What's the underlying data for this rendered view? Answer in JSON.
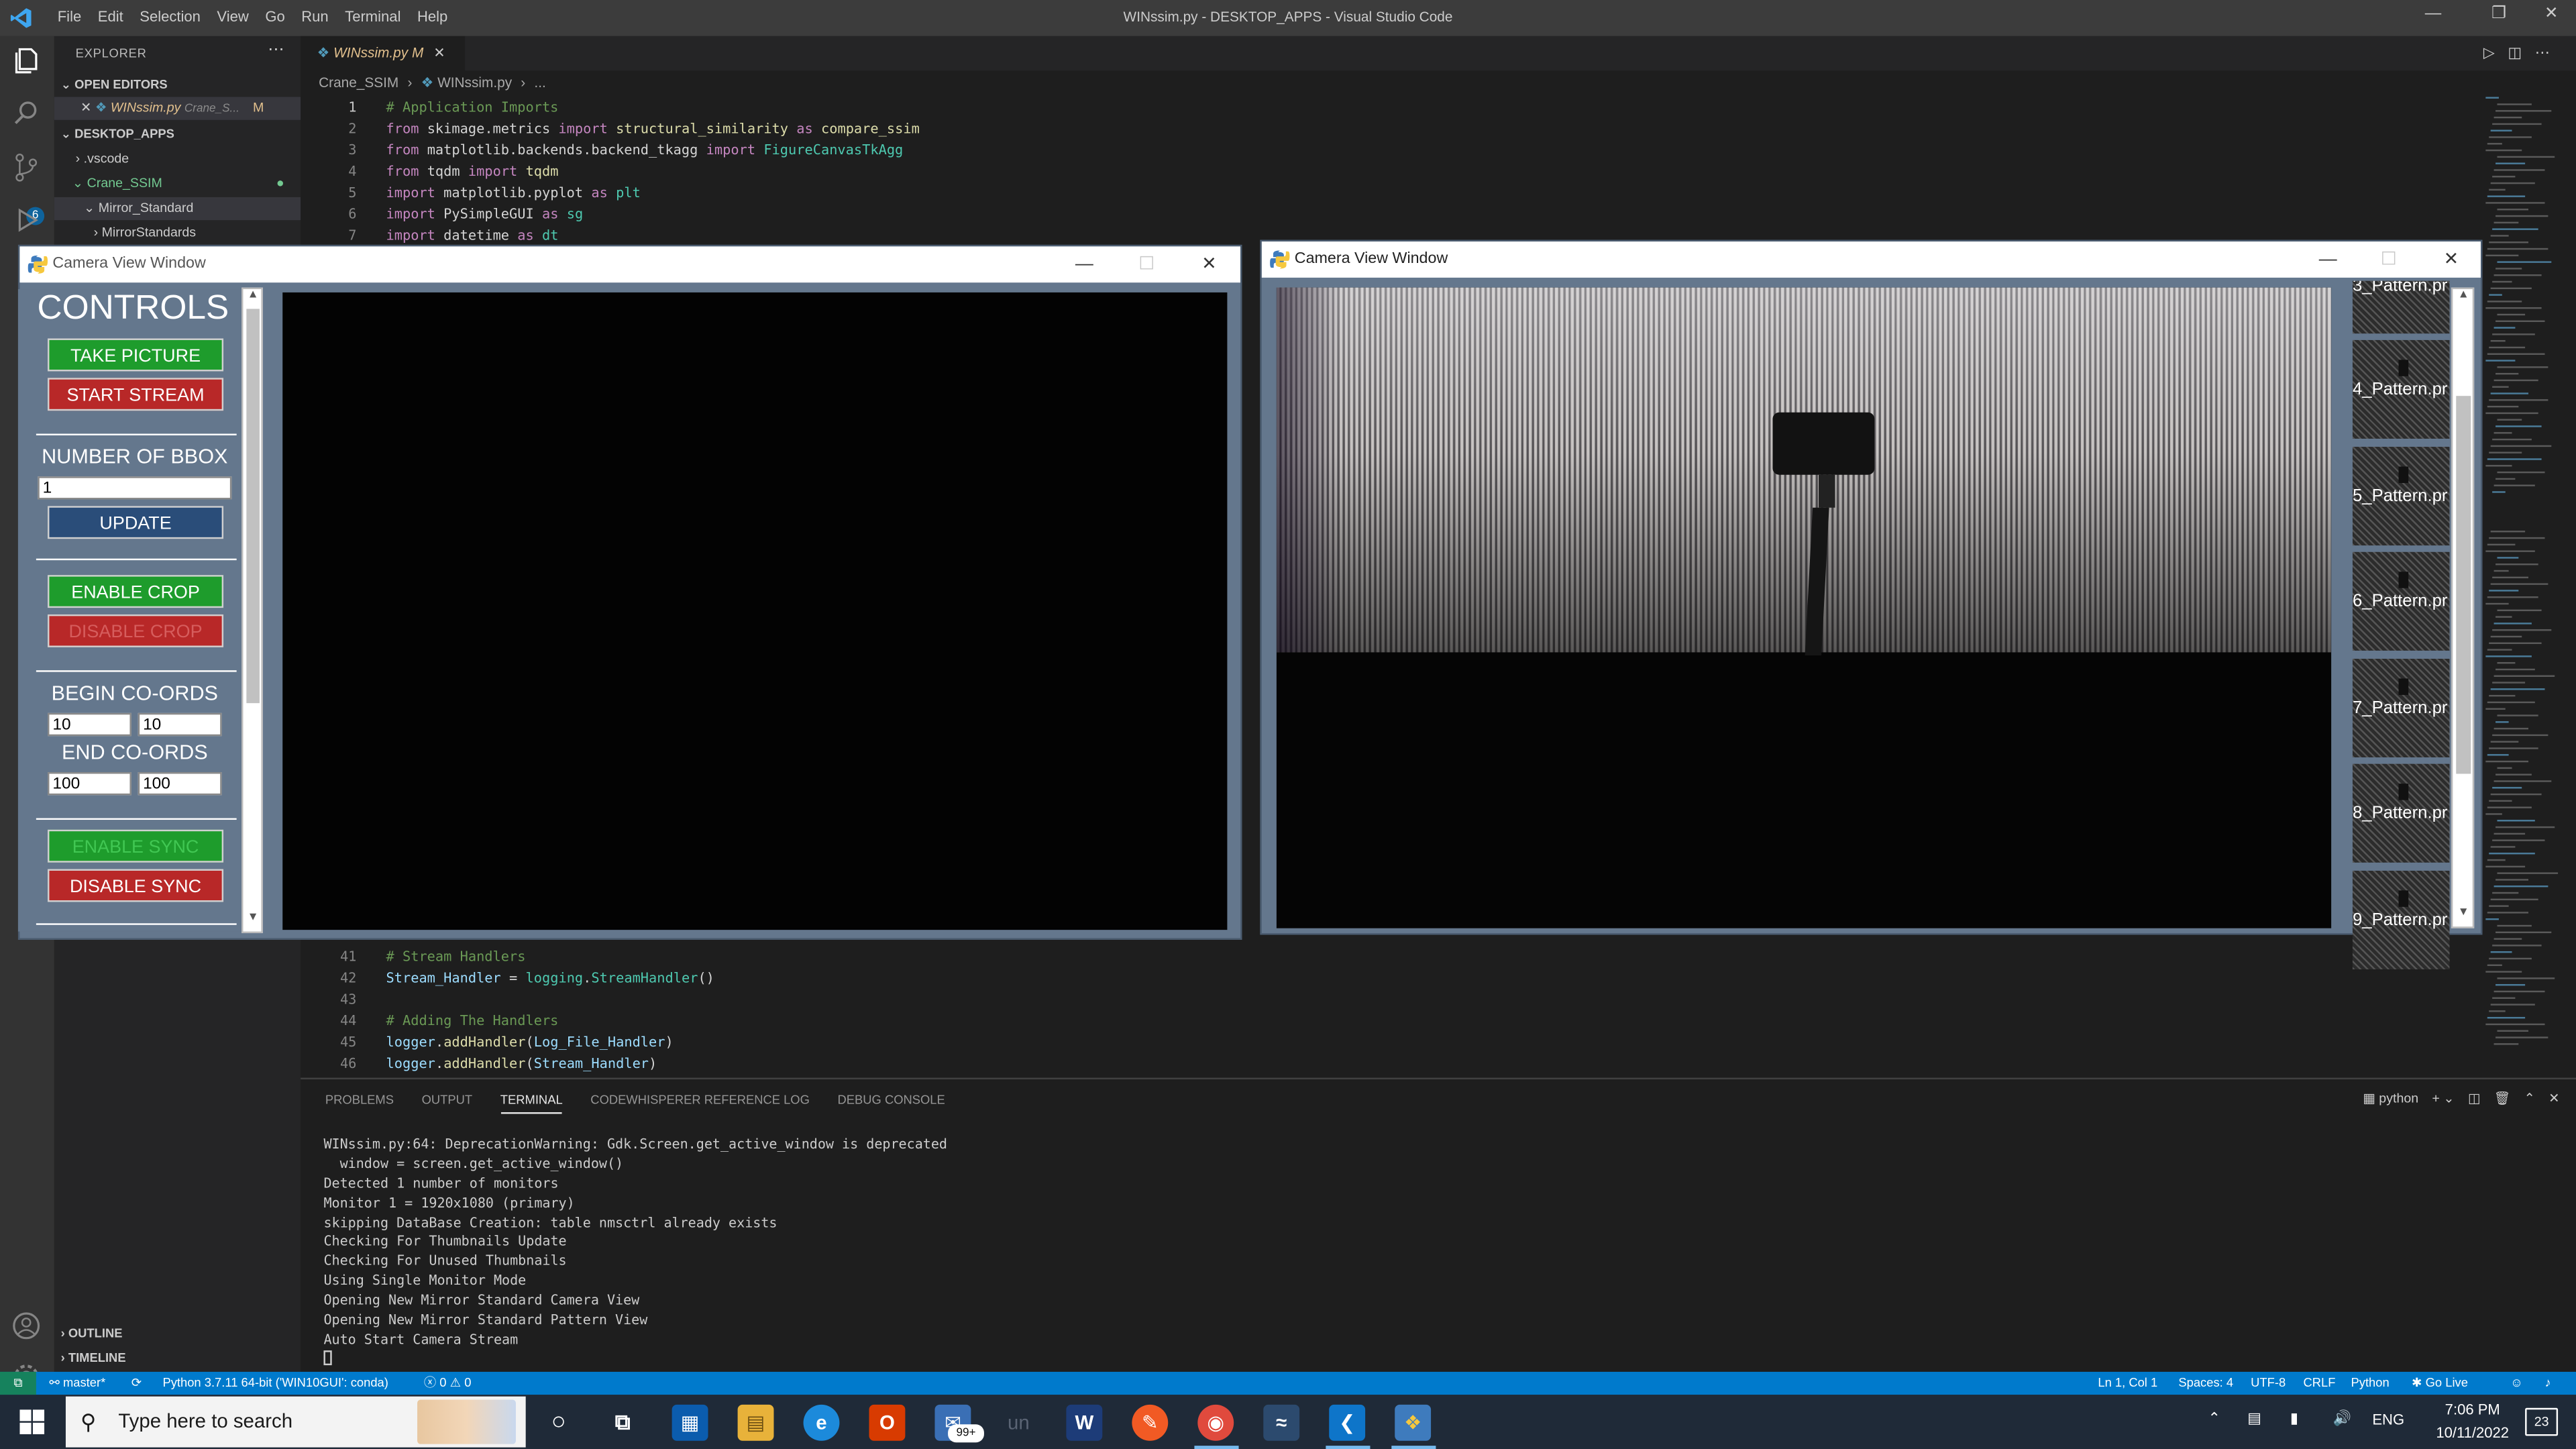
{
  "vscode": {
    "menu": [
      "File",
      "Edit",
      "Selection",
      "View",
      "Go",
      "Run",
      "Terminal",
      "Help"
    ],
    "window_title": "WINssim.py - DESKTOP_APPS - Visual Studio Code",
    "explorer_label": "EXPLORER",
    "open_editors_label": "OPEN EDITORS",
    "open_editor_file": "WINssim.py",
    "open_editor_path": "Crane_S...",
    "open_editor_status": "M",
    "workspace_label": "DESKTOP_APPS",
    "tree": [
      ".vscode",
      "Crane_SSIM",
      "Mirror_Standard",
      "MirrorStandards"
    ],
    "tab_label": "WINssim.py",
    "tab_status": "M",
    "breadcrumb": [
      "Crane_SSIM",
      "WINssim.py",
      "..."
    ],
    "code_top": [
      {
        "n": "1",
        "tokens": [
          [
            "cm",
            "# Application Imports"
          ]
        ]
      },
      {
        "n": "2",
        "tokens": [
          [
            "kw",
            "from"
          ],
          [
            "",
            " skimage.metrics "
          ],
          [
            "kw",
            "import"
          ],
          [
            "",
            " "
          ],
          [
            "fn",
            "structural_similarity"
          ],
          [
            "",
            " "
          ],
          [
            "kw",
            "as"
          ],
          [
            "",
            " "
          ],
          [
            "fn",
            "compare_ssim"
          ]
        ]
      },
      {
        "n": "3",
        "tokens": [
          [
            "kw",
            "from"
          ],
          [
            "",
            " matplotlib.backends.backend_tkagg "
          ],
          [
            "kw",
            "import"
          ],
          [
            "",
            " "
          ],
          [
            "cls",
            "FigureCanvasTkAgg"
          ]
        ]
      },
      {
        "n": "4",
        "tokens": [
          [
            "kw",
            "from"
          ],
          [
            "",
            " tqdm "
          ],
          [
            "kw",
            "import"
          ],
          [
            "",
            " "
          ],
          [
            "fn",
            "tqdm"
          ]
        ]
      },
      {
        "n": "5",
        "tokens": [
          [
            "kw",
            "import"
          ],
          [
            "",
            " matplotlib.pyplot "
          ],
          [
            "kw",
            "as"
          ],
          [
            "",
            " "
          ],
          [
            "cls",
            "plt"
          ]
        ]
      },
      {
        "n": "6",
        "tokens": [
          [
            "kw",
            "import"
          ],
          [
            "",
            " PySimpleGUI "
          ],
          [
            "kw",
            "as"
          ],
          [
            "",
            " "
          ],
          [
            "cls",
            "sg"
          ]
        ]
      },
      {
        "n": "7",
        "tokens": [
          [
            "kw",
            "import"
          ],
          [
            "",
            " datetime "
          ],
          [
            "kw",
            "as"
          ],
          [
            "",
            " "
          ],
          [
            "cls",
            "dt"
          ]
        ]
      }
    ],
    "code_bottom": [
      {
        "n": "41",
        "tokens": [
          [
            "cm",
            "# Stream Handlers"
          ]
        ]
      },
      {
        "n": "42",
        "tokens": [
          [
            "var",
            "Stream_Handler"
          ],
          [
            "",
            " = "
          ],
          [
            "cls",
            "logging"
          ],
          [
            "",
            "."
          ],
          [
            "cls",
            "StreamHandler"
          ],
          [
            "",
            "()"
          ]
        ]
      },
      {
        "n": "43",
        "tokens": []
      },
      {
        "n": "44",
        "tokens": [
          [
            "cm",
            "# Adding The Handlers"
          ]
        ]
      },
      {
        "n": "45",
        "tokens": [
          [
            "var",
            "logger"
          ],
          [
            "",
            "."
          ],
          [
            "fn",
            "addHandler"
          ],
          [
            "",
            "("
          ],
          [
            "var",
            "Log_File_Handler"
          ],
          [
            "",
            ")"
          ]
        ]
      },
      {
        "n": "46",
        "tokens": [
          [
            "var",
            "logger"
          ],
          [
            "",
            "."
          ],
          [
            "fn",
            "addHandler"
          ],
          [
            "",
            "("
          ],
          [
            "var",
            "Stream_Handler"
          ],
          [
            "",
            ")"
          ]
        ]
      }
    ],
    "panel_tabs": [
      "PROBLEMS",
      "OUTPUT",
      "TERMINAL",
      "CODEWHISPERER REFERENCE LOG",
      "DEBUG CONSOLE"
    ],
    "terminal_shell": "python",
    "terminal_lines": [
      "WINssim.py:64: DeprecationWarning: Gdk.Screen.get_active_window is deprecated",
      "  window = screen.get_active_window()",
      "Detected 1 number of monitors",
      "Monitor 1 = 1920x1080 (primary)",
      "skipping DataBase Creation: table nmsctrl already exists",
      "Checking For Thumbnails Update",
      "Checking For Unused Thumbnails",
      "Using Single Monitor Mode",
      "Opening New Mirror Standard Camera View",
      "Opening New Mirror Standard Pattern View",
      "Auto Start Camera Stream"
    ],
    "outline_label": "OUTLINE",
    "timeline_label": "TIMELINE",
    "status": {
      "branch": "master*",
      "python": "Python 3.7.11 64-bit ('WIN10GUI': conda)",
      "problems": "ⓧ 0 ⚠ 0",
      "position": "Ln 1, Col 1",
      "spaces": "Spaces: 4",
      "encoding": "UTF-8",
      "eol": "CRLF",
      "language": "Python",
      "golive": "Go Live"
    }
  },
  "camera_left": {
    "title": "Camera View Window",
    "controls_title": "CONTROLS",
    "take_picture": "TAKE PICTURE",
    "start_stream": "START STREAM",
    "bbox_label": "NUMBER OF BBOX",
    "bbox_value": "1",
    "update": "UPDATE",
    "enable_crop": "ENABLE CROP",
    "disable_crop": "DISABLE CROP",
    "begin_label": "BEGIN CO-ORDS",
    "begin_x": "10",
    "begin_y": "10",
    "end_label": "END CO-ORDS",
    "end_x": "100",
    "end_y": "100",
    "enable_sync": "ENABLE SYNC",
    "disable_sync": "DISABLE SYNC"
  },
  "camera_right": {
    "title": "Camera View Window",
    "thumbnails": [
      "3_Pattern.pr",
      "4_Pattern.pr",
      "5_Pattern.pr",
      "6_Pattern.pr",
      "7_Pattern.pr",
      "8_Pattern.pr",
      "9_Pattern.pr"
    ]
  },
  "taskbar": {
    "search_placeholder": "Type here to search",
    "mail_badge": "99+",
    "language": "ENG",
    "time": "7:06 PM",
    "date": "10/11/2022",
    "notifications": "23"
  },
  "colors": {
    "vscode_blue": "#007acc",
    "button_green": "#1e9c2c",
    "button_red": "#b82828",
    "button_blue": "#2a4d79",
    "window_bg": "#64778d"
  }
}
